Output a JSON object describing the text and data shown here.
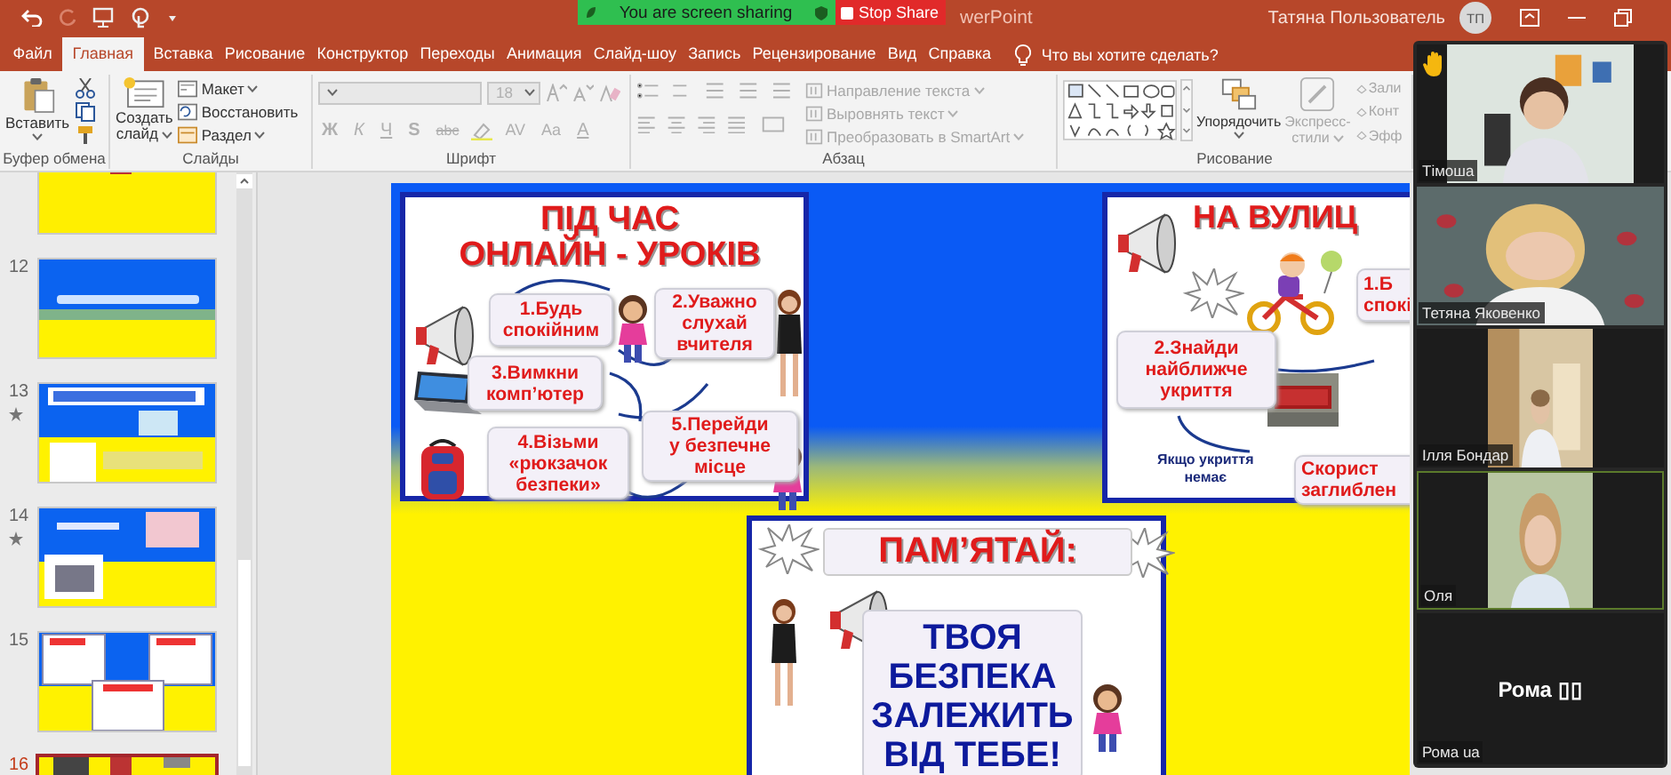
{
  "title_bar": {
    "document_title": "werPoint",
    "user_name": "Татяна Пользователь",
    "user_initials": "ТП"
  },
  "share_bar": {
    "status": "You are screen sharing",
    "stop_label": "Stop Share"
  },
  "ribbon_tabs": [
    {
      "label": "Файл",
      "selected": false
    },
    {
      "label": "Главная",
      "selected": true
    },
    {
      "label": "Вставка",
      "selected": false
    },
    {
      "label": "Рисование",
      "selected": false
    },
    {
      "label": "Конструктор",
      "selected": false
    },
    {
      "label": "Переходы",
      "selected": false
    },
    {
      "label": "Анимация",
      "selected": false
    },
    {
      "label": "Слайд-шоу",
      "selected": false
    },
    {
      "label": "Запись",
      "selected": false
    },
    {
      "label": "Рецензирование",
      "selected": false
    },
    {
      "label": "Вид",
      "selected": false
    },
    {
      "label": "Справка",
      "selected": false
    }
  ],
  "tell_me": "Что вы хотите сделать?",
  "ribbon_groups": [
    {
      "kind": "clipboard",
      "label": "Буфер обмена",
      "paste": "Вставить"
    },
    {
      "kind": "slides",
      "label": "Слайды",
      "new_slide": [
        "Создать",
        "слайд"
      ],
      "items": [
        {
          "label": "Макет",
          "menu": true
        },
        {
          "label": "Восстановить",
          "menu": false
        },
        {
          "label": "Раздел",
          "menu": true
        }
      ]
    },
    {
      "kind": "font",
      "label": "Шрифт",
      "disabled": true,
      "font_size": "18",
      "format_buttons": [
        "Ж",
        "К",
        "Ч",
        "S",
        "abc",
        "AV",
        "Aa",
        "A"
      ]
    },
    {
      "kind": "paragraph",
      "label": "Абзац",
      "items": [
        {
          "label": "Направление текста",
          "disabled": true
        },
        {
          "label": "Выровнять текст",
          "disabled": true
        },
        {
          "label": "Преобразовать в SmartArt",
          "disabled": true
        }
      ]
    },
    {
      "kind": "drawing",
      "label": "Рисование",
      "arrange": "Упорядочить",
      "quick_styles": {
        "lines": [
          "Экспресс-",
          "стили"
        ],
        "disabled": true
      },
      "items": [
        {
          "label": "Зали",
          "disabled": true
        },
        {
          "label": "Конт",
          "disabled": true
        },
        {
          "label": "Эфф",
          "disabled": true
        }
      ]
    }
  ],
  "slide_thumbnails": [
    {
      "selected": false,
      "animated": false
    },
    {
      "number": "12",
      "selected": false,
      "animated": false
    },
    {
      "number": "13",
      "selected": false,
      "animated": true
    },
    {
      "number": "14",
      "selected": false,
      "animated": true
    },
    {
      "number": "15",
      "selected": false,
      "animated": false
    },
    {
      "number": "16",
      "selected": true,
      "animated": false
    }
  ],
  "slide": {
    "posters": [
      {
        "kind": "online",
        "title": [
          "ПІД ЧАС",
          "ОНЛАЙН - УРОКІВ"
        ],
        "steps": [
          {
            "lines": [
              "1.Будь",
              "спокійним"
            ]
          },
          {
            "lines": [
              "2.Уважно",
              "слухай",
              "вчителя"
            ]
          },
          {
            "lines": [
              "3.Вимкни",
              "комп’ютер"
            ]
          },
          {
            "lines": [
              "4.Візьми",
              "«рюкзачок",
              "безпеки»"
            ]
          },
          {
            "lines": [
              "5.Перейди",
              "у безпечне",
              "місце"
            ]
          }
        ]
      },
      {
        "kind": "street",
        "title": [
          "НА ВУЛИЦ"
        ],
        "steps": [
          {
            "lines": [
              "1.Б",
              "спокі"
            ]
          },
          {
            "lines": [
              "2.Знайди",
              "найближче",
              "укриття"
            ]
          },
          {
            "lines": [
              "Скорист",
              "заглиблен"
            ]
          }
        ],
        "note": [
          "Якщо укриття",
          "немає"
        ]
      },
      {
        "kind": "remember",
        "title": [
          "ПАМ’ЯТАЙ:"
        ],
        "message": [
          "ТВОЯ",
          "БЕЗПЕКА",
          "ЗАЛЕЖИТЬ",
          "ВІД ТЕБЕ!"
        ]
      }
    ]
  },
  "participants": [
    {
      "name": "Тімоша",
      "video": true,
      "hand_raised": true,
      "active": false
    },
    {
      "name": "Тетяна Яковенко",
      "video": true,
      "hand_raised": false,
      "active": false
    },
    {
      "name": "Ілля Бондар",
      "video": true,
      "hand_raised": false,
      "active": false
    },
    {
      "name": "Оля",
      "video": true,
      "hand_raised": false,
      "active": true
    },
    {
      "name": "Рома ua",
      "display_name": "Рома ▯▯",
      "video": false,
      "hand_raised": false,
      "active": false
    }
  ]
}
